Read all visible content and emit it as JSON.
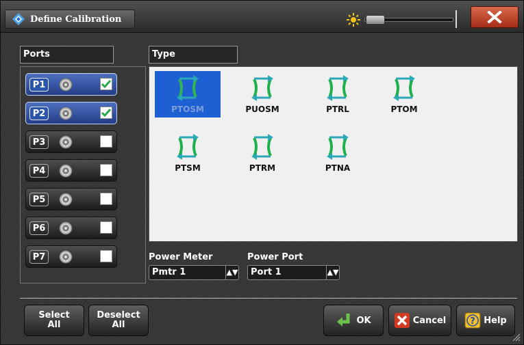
{
  "window": {
    "title": "Define Calibration"
  },
  "ports_section": {
    "label": "Ports",
    "ports": [
      {
        "label": "P1",
        "checked": true
      },
      {
        "label": "P2",
        "checked": true
      },
      {
        "label": "P3",
        "checked": false
      },
      {
        "label": "P4",
        "checked": false
      },
      {
        "label": "P5",
        "checked": false
      },
      {
        "label": "P6",
        "checked": false
      },
      {
        "label": "P7",
        "checked": false
      }
    ]
  },
  "type_section": {
    "label": "Type",
    "items": [
      {
        "label": "PTOSM",
        "selected": true
      },
      {
        "label": "PUOSM",
        "selected": false
      },
      {
        "label": "PTRL",
        "selected": false
      },
      {
        "label": "PTOM",
        "selected": false
      },
      {
        "label": "PTSM",
        "selected": false
      },
      {
        "label": "PTRM",
        "selected": false
      },
      {
        "label": "PTNA",
        "selected": false
      }
    ]
  },
  "power_meter": {
    "label": "Power Meter",
    "value": "Pmtr 1"
  },
  "power_port": {
    "label": "Power Port",
    "value": "Port 1"
  },
  "buttons": {
    "select_all": [
      "Select",
      "All"
    ],
    "deselect_all": [
      "Deselect",
      "All"
    ],
    "ok": "OK",
    "cancel": "Cancel",
    "help": "Help"
  },
  "colors": {
    "accent": "#1e5fd3",
    "close": "#c0391f",
    "arrow_green": "#22b24c",
    "arrow_teal": "#2aa8b8"
  }
}
